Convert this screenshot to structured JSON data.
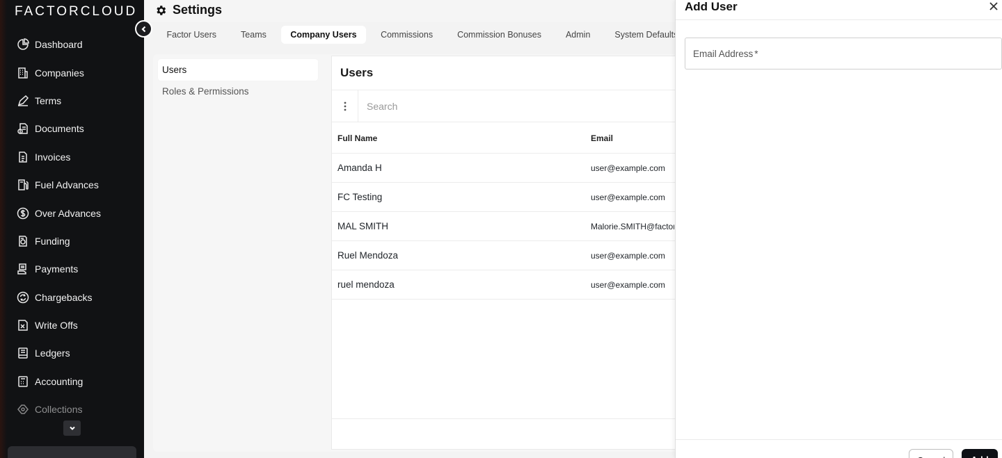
{
  "brand": "FACTORCLOUD",
  "sidebar": {
    "items": [
      {
        "label": "Dashboard",
        "icon": "dashboard-icon"
      },
      {
        "label": "Companies",
        "icon": "building-icon"
      },
      {
        "label": "Terms",
        "icon": "pen-icon"
      },
      {
        "label": "Documents",
        "icon": "documents-icon"
      },
      {
        "label": "Invoices",
        "icon": "invoice-icon"
      },
      {
        "label": "Fuel Advances",
        "icon": "fuel-icon"
      },
      {
        "label": "Over Advances",
        "icon": "dollar-circle-icon"
      },
      {
        "label": "Funding",
        "icon": "funding-icon"
      },
      {
        "label": "Payments",
        "icon": "payments-icon"
      },
      {
        "label": "Chargebacks",
        "icon": "chargeback-icon"
      },
      {
        "label": "Write Offs",
        "icon": "write-off-icon"
      },
      {
        "label": "Ledgers",
        "icon": "ledger-icon"
      },
      {
        "label": "Accounting",
        "icon": "calculator-icon"
      },
      {
        "label": "Collections",
        "icon": "collections-icon"
      }
    ]
  },
  "header": {
    "title": "Settings"
  },
  "tabs": [
    {
      "label": "Factor Users"
    },
    {
      "label": "Teams"
    },
    {
      "label": "Company Users"
    },
    {
      "label": "Commissions"
    },
    {
      "label": "Commission Bonuses"
    },
    {
      "label": "Admin"
    },
    {
      "label": "System Defaults"
    }
  ],
  "subnav": [
    {
      "label": "Users"
    },
    {
      "label": "Roles & Permissions"
    }
  ],
  "users": {
    "title": "Users",
    "search_placeholder": "Search",
    "columns": {
      "name": "Full Name",
      "email": "Email"
    },
    "rows": [
      {
        "name": "Amanda H",
        "email": "user@example.com"
      },
      {
        "name": "FC Testing",
        "email": "user@example.com"
      },
      {
        "name": "MAL SMITH",
        "email": "Malorie.SMITH@factorcloud.com"
      },
      {
        "name": "Ruel Mendoza",
        "email": "user@example.com"
      },
      {
        "name": "ruel mendoza",
        "email": "user@example.com"
      }
    ]
  },
  "drawer": {
    "title": "Add User",
    "email_label": "Email Address",
    "required_mark": "*",
    "cancel_label": "Cancel",
    "add_label": "Add"
  }
}
